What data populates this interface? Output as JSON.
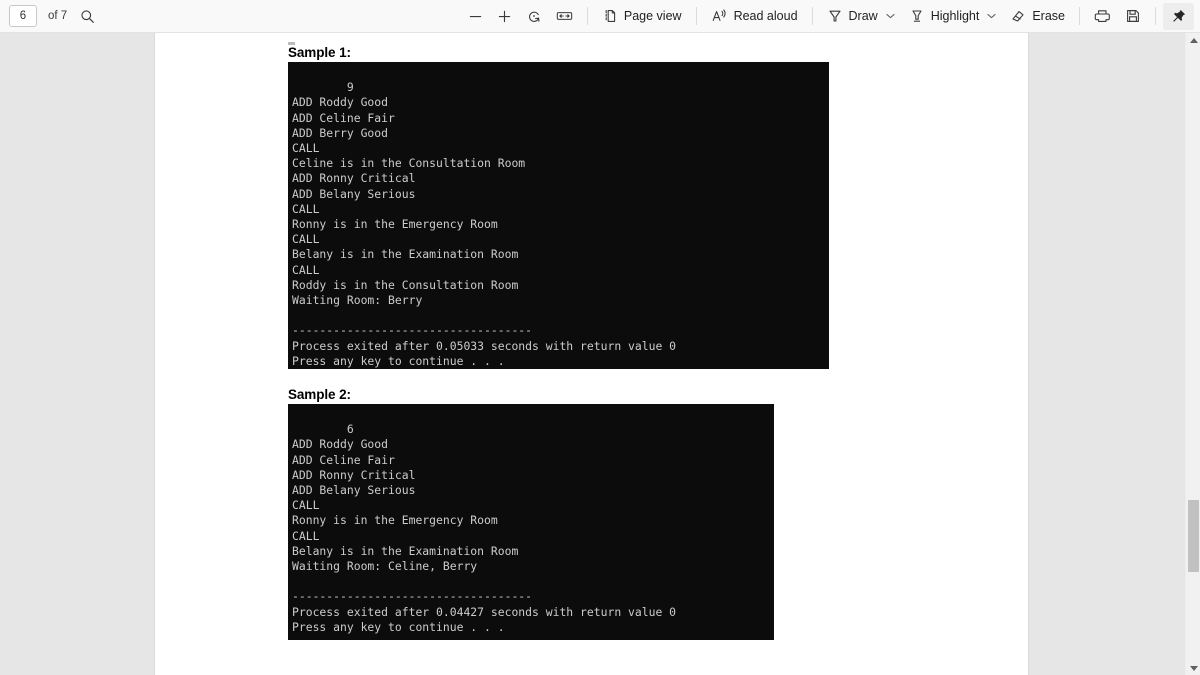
{
  "toolbar": {
    "page_number": "6",
    "page_total_label": "of 7",
    "search_icon": "search-icon",
    "zoom_out_icon": "minus-icon",
    "zoom_in_icon": "plus-icon",
    "rotate_icon": "rotate-icon",
    "fit_width_icon": "fit-to-width-icon",
    "page_view_label": "Page view",
    "page_view_icon": "page-view-icon",
    "read_aloud_label": "Read aloud",
    "read_aloud_icon": "read-aloud-icon",
    "draw_label": "Draw",
    "draw_icon": "draw-pen-icon",
    "draw_caret": "⌄",
    "highlight_label": "Highlight",
    "highlight_icon": "highlight-pen-icon",
    "highlight_caret": "⌄",
    "erase_label": "Erase",
    "erase_icon": "eraser-icon",
    "print_icon": "print-icon",
    "save_icon": "save-icon",
    "pin_icon": "pin-icon"
  },
  "document": {
    "sample1": {
      "heading": "Sample 1:",
      "console_text": "9\nADD Roddy Good\nADD Celine Fair\nADD Berry Good\nCALL\nCeline is in the Consultation Room\nADD Ronny Critical\nADD Belany Serious\nCALL\nRonny is in the Emergency Room\nCALL\nBelany is in the Examination Room\nCALL\nRoddy is in the Consultation Room\nWaiting Room: Berry\n\n-----------------------------------\nProcess exited after 0.05033 seconds with return value 0\nPress any key to continue . . ."
    },
    "sample2": {
      "heading": "Sample 2:",
      "console_text": "6\nADD Roddy Good\nADD Celine Fair\nADD Ronny Critical\nADD Belany Serious\nCALL\nRonny is in the Emergency Room\nCALL\nBelany is in the Examination Room\nWaiting Room: Celine, Berry\n\n-----------------------------------\nProcess exited after 0.04427 seconds with return value 0\nPress any key to continue . . ."
    }
  },
  "scrollbar": {
    "up_arrow": "scroll-up-arrow",
    "down_arrow": "scroll-down-arrow"
  },
  "colors": {
    "console_bg": "#0c0c0c",
    "console_fg": "#cccccc",
    "toolbar_bg": "#f9f9f9",
    "viewer_bg": "#e6e6e6",
    "page_bg": "#ffffff",
    "scroll_thumb": "#c1c1c1"
  }
}
